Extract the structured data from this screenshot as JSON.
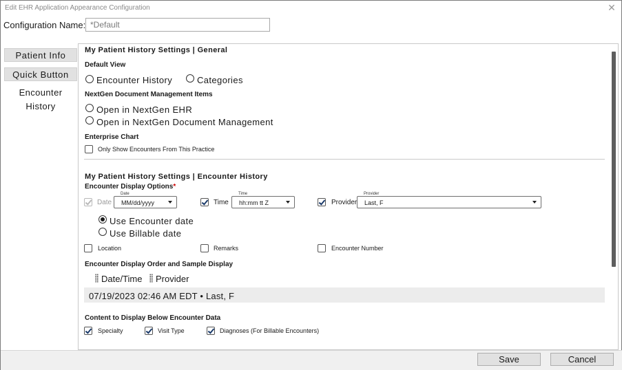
{
  "window": {
    "title": "Edit EHR Application Appearance Configuration",
    "close_glyph": "✕"
  },
  "config": {
    "label": "Configuration Name:",
    "value": "*Default"
  },
  "sidebar": {
    "items": [
      {
        "label": "Patient  Info"
      },
      {
        "label": "Quick Button"
      },
      {
        "label": "Encounter  History"
      }
    ],
    "active_index": 2
  },
  "general": {
    "heading": "My  Patient  History  Settings  |  General",
    "default_view": {
      "label": "Default View",
      "options": [
        "Encounter  History",
        "Categories"
      ]
    },
    "doc_mgmt": {
      "label": "NextGen Document Management Items",
      "options": [
        "Open  in  NextGen  EHR",
        "Open  in  NextGen  Document  Management"
      ]
    },
    "enterprise": {
      "label": "Enterprise Chart",
      "checkbox_label": "Only Show Encounters From This Practice"
    }
  },
  "encounter": {
    "heading": "My  Patient  History  Settings  |  Encounter  History",
    "display_options_label": "Encounter Display Options",
    "required_mark": "*",
    "date": {
      "label": "Date",
      "legend": "Date",
      "value": "MM/dd/yyyy",
      "checked": true,
      "disabled": true
    },
    "time": {
      "label": "Time",
      "legend": "Time",
      "value": "hh:mm tt Z",
      "checked": true
    },
    "provider": {
      "label": "Provider",
      "legend": "Provider",
      "value": "Last, F",
      "checked": true
    },
    "date_source": {
      "options": [
        "Use  Encounter  date",
        "Use  Billable  date"
      ],
      "selected": 0
    },
    "extras": [
      {
        "label": "Location",
        "checked": false
      },
      {
        "label": "Remarks",
        "checked": false
      },
      {
        "label": "Encounter Number",
        "checked": false
      }
    ],
    "order_label": "Encounter Display Order and Sample Display",
    "order_items": [
      "Date/Time",
      "Provider"
    ],
    "sample": "07/19/2023  02:46  AM  EDT • Last,  F",
    "below_label": "Content to Display Below Encounter Data",
    "below_items": [
      {
        "label": "Specialty",
        "checked": true
      },
      {
        "label": "Visit Type",
        "checked": true
      },
      {
        "label": "Diagnoses (For Billable Encounters)",
        "checked": true
      }
    ]
  },
  "footer": {
    "save_label": "Save",
    "cancel_label": "Cancel"
  },
  "colors": {
    "scrollbar": "#5e5e5e",
    "required": "#cc0000",
    "checkbox_mark": "#1a3a6a"
  }
}
